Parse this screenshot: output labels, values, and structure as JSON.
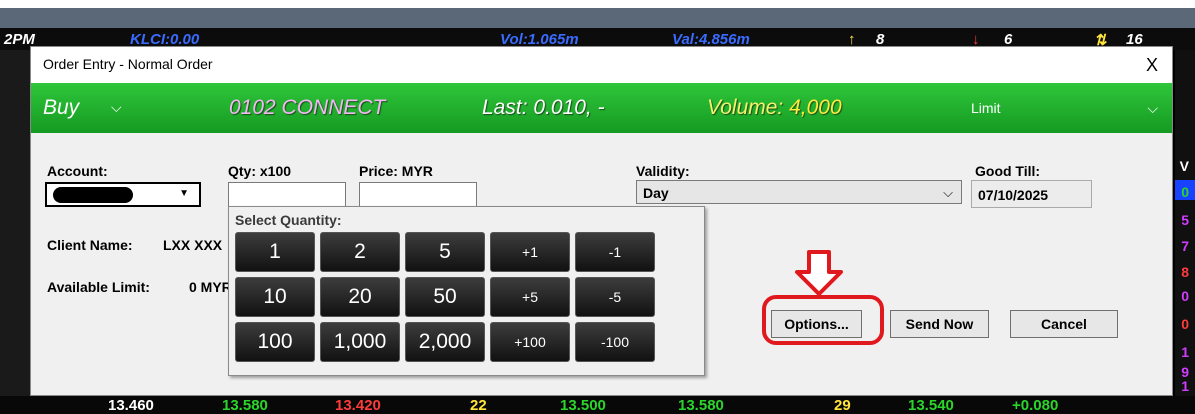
{
  "background": {
    "ticker": {
      "time_suffix": "2PM",
      "klci": "KLCI:0.00",
      "vol": "Vol:1.065m",
      "val": "Val:4.856m",
      "up": "8",
      "down": "6",
      "unch": "16"
    },
    "right_column": [
      "V",
      "0",
      "5",
      "7",
      "8",
      "0",
      "0",
      "1",
      "9",
      "1"
    ],
    "bottom_row": [
      "13.460",
      "13.580",
      "13.420",
      "22",
      "13.500",
      "13.580",
      "29",
      "13.540",
      "+0.080"
    ],
    "colors": {
      "up": "#2bd62b",
      "down": "#ff3b3b",
      "neutral": "#ffffff",
      "yellow": "#ffe43a",
      "blue": "#3a6bff",
      "magenta": "#d23cff"
    }
  },
  "dialog": {
    "title": "Order Entry - Normal Order",
    "close_label": "X",
    "header": {
      "side": "Buy",
      "stock": "0102 CONNECT",
      "last_prefix": "Last: ",
      "last_value": "0.010, -",
      "volume_prefix": "Volume: ",
      "volume_value": "4,000",
      "order_type": "Limit",
      "colors": {
        "bar": "#1fae2b",
        "stock": "#f4b7f4",
        "volume": "#f5f36a"
      }
    },
    "fields": {
      "account_label": "Account:",
      "qty_label": "Qty: x100",
      "price_label": "Price: MYR",
      "validity_label": "Validity:",
      "validity_value": "Day",
      "good_till_label": "Good Till:",
      "good_till_value": "07/10/2025",
      "client_name_label": "Client Name:",
      "client_name_value": "LXX XXX",
      "available_limit_label": "Available Limit:",
      "available_limit_value": "0 MYR"
    },
    "quantity_panel": {
      "title": "Select Quantity:",
      "rows": [
        [
          "1",
          "2",
          "5",
          "+1",
          "-1"
        ],
        [
          "10",
          "20",
          "50",
          "+5",
          "-5"
        ],
        [
          "100",
          "1,000",
          "2,000",
          "+100",
          "-100"
        ]
      ]
    },
    "buttons": {
      "options": "Options...",
      "send_now": "Send Now",
      "cancel": "Cancel"
    },
    "annotation_color": "#e0191e"
  }
}
